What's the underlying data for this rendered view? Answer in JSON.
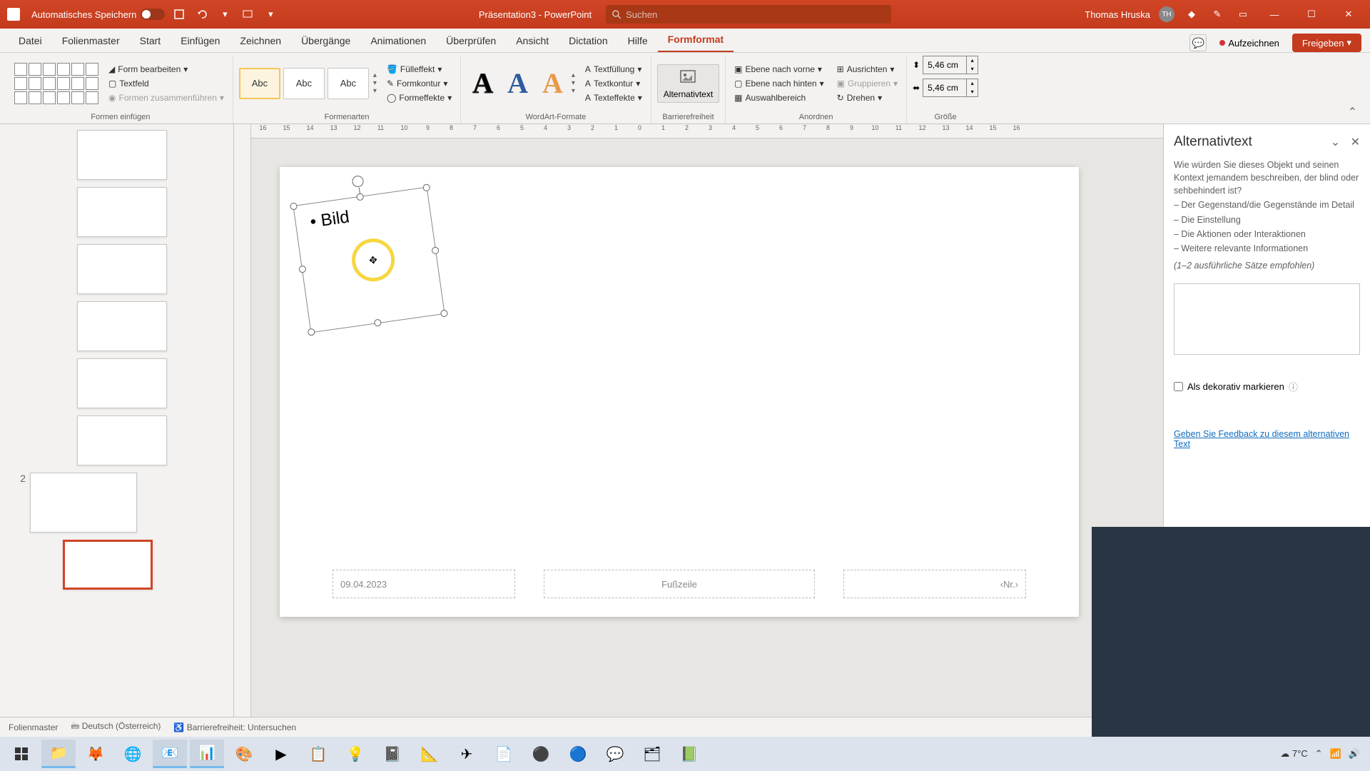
{
  "titlebar": {
    "autosave_label": "Automatisches Speichern",
    "doc_name": "Präsentation3",
    "app_name": "PowerPoint",
    "search_placeholder": "Suchen",
    "user_name": "Thomas Hruska",
    "user_initials": "TH"
  },
  "menu": {
    "items": [
      "Datei",
      "Folienmaster",
      "Start",
      "Einfügen",
      "Zeichnen",
      "Übergänge",
      "Animationen",
      "Überprüfen",
      "Ansicht",
      "Dictation",
      "Hilfe",
      "Formformat"
    ],
    "active_index": 11,
    "record": "Aufzeichnen",
    "share": "Freigeben"
  },
  "ribbon": {
    "g1_label": "Formen einfügen",
    "edit_shape": "Form bearbeiten",
    "textbox": "Textfeld",
    "merge": "Formen zusammenführen",
    "g2_label": "Formenarten",
    "style_text": "Abc",
    "fill": "Fülleffekt",
    "outline": "Formkontur",
    "effects": "Formeffekte",
    "g3_label": "WordArt-Formate",
    "text_fill": "Textfüllung",
    "text_outline": "Textkontur",
    "text_effects": "Texteffekte",
    "g4_label": "Barrierefreiheit",
    "alt_text": "Alternativtext",
    "g5_label": "Anordnen",
    "bring_fwd": "Ebene nach vorne",
    "send_back": "Ebene nach hinten",
    "selection": "Auswahlbereich",
    "align": "Ausrichten",
    "group": "Gruppieren",
    "rotate": "Drehen",
    "g6_label": "Größe",
    "height": "5,46 cm",
    "width": "5,46 cm"
  },
  "ruler": [
    "16",
    "15",
    "14",
    "13",
    "12",
    "11",
    "10",
    "9",
    "8",
    "7",
    "6",
    "5",
    "4",
    "3",
    "2",
    "1",
    "0",
    "1",
    "2",
    "3",
    "4",
    "5",
    "6",
    "7",
    "8",
    "9",
    "10",
    "11",
    "12",
    "13",
    "14",
    "15",
    "16"
  ],
  "slide": {
    "bullet_text": "Bild",
    "date": "09.04.2023",
    "footer": "Fußzeile",
    "page": "‹Nr.›"
  },
  "thumbs": {
    "section2": "2"
  },
  "panel": {
    "title": "Alternativtext",
    "intro": "Wie würden Sie dieses Objekt und seinen Kontext jemandem beschreiben, der blind oder sehbehindert ist?",
    "li1": "– Der Gegenstand/die Gegenstände im Detail",
    "li2": "– Die Einstellung",
    "li3": "– Die Aktionen oder Interaktionen",
    "li4": "– Weitere relevante Informationen",
    "hint": "(1–2 ausführliche Sätze empfohlen)",
    "decorative": "Als dekorativ markieren",
    "feedback": "Geben Sie Feedback zu diesem alternativen Text"
  },
  "status": {
    "view": "Folienmaster",
    "lang": "Deutsch (Österreich)",
    "access": "Barrierefreiheit: Untersuchen"
  },
  "tray": {
    "temp": "7°C"
  }
}
